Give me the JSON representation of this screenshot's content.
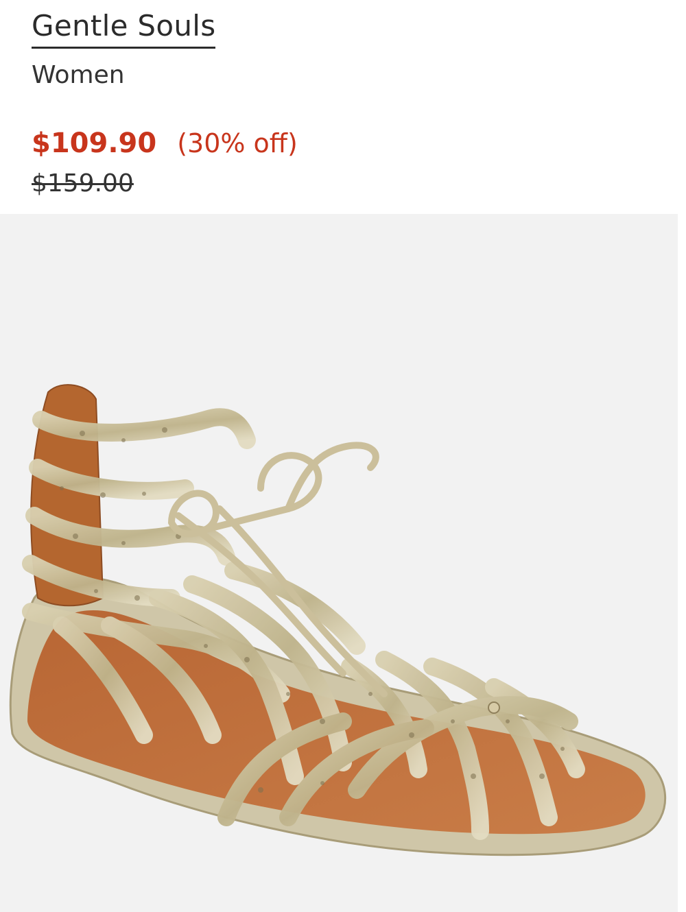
{
  "product": {
    "brand": "Gentle Souls",
    "category": "Women",
    "sale_price": "$109.90",
    "discount": "(30% off)",
    "original_price": "$159.00",
    "image_icon": "metallic-gladiator-sandal-image"
  },
  "colors": {
    "sale": "#c8351c",
    "text": "#2b2b2b",
    "image_background": "#f2f2f2"
  }
}
